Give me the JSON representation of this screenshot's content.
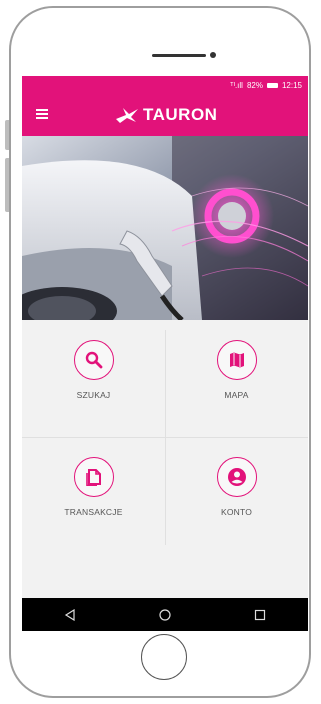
{
  "status_bar": {
    "signal": "ᵀᴵ.ıll",
    "battery": "82%",
    "time": "12:15"
  },
  "app": {
    "brand": "TAURON"
  },
  "tiles": [
    {
      "label": "SZUKAJ",
      "icon": "search-icon"
    },
    {
      "label": "MAPA",
      "icon": "map-icon"
    },
    {
      "label": "TRANSAKCJE",
      "icon": "document-icon"
    },
    {
      "label": "KONTO",
      "icon": "account-icon"
    }
  ],
  "colors": {
    "accent": "#e2127a",
    "background": "#f2f2f2",
    "navbar": "#000000"
  },
  "nav_bar": {
    "buttons": [
      "back-icon",
      "home-icon",
      "recents-icon"
    ]
  }
}
